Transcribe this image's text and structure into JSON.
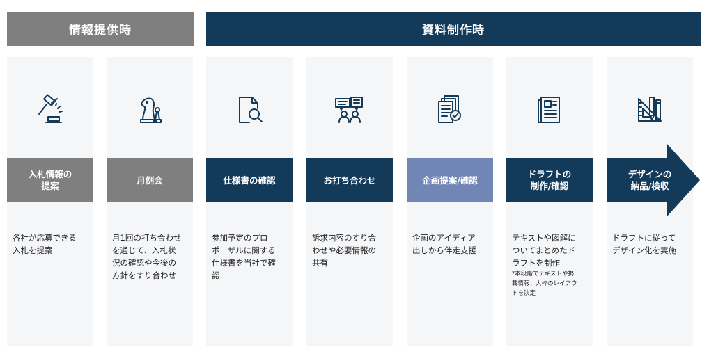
{
  "headers": {
    "left": "情報提供時",
    "right": "資料制作時"
  },
  "steps": [
    {
      "title": "入札情報の\n提案",
      "icon": "gavel-icon",
      "description": "各社が応募できる\n入札を提案"
    },
    {
      "title": "月例会",
      "icon": "chess-icon",
      "description": "月1回の打ち合わせ\nを通じて、入札状\n況の確認や今後の\n方針をすり合わせ"
    },
    {
      "title": "仕様書の確認",
      "icon": "document-search-icon",
      "description": "参加予定のプロ\nポーザルに関する\n仕様書を当社で確\n認"
    },
    {
      "title": "お打ち合わせ",
      "icon": "meeting-icon",
      "description": "訴求内容のすり合\nわせや必要情報の\n共有"
    },
    {
      "title": "企画提案/確認",
      "icon": "documents-check-icon",
      "description": "企画のアイディア\n出しから伴走支援"
    },
    {
      "title": "ドラフトの\n制作/確認",
      "icon": "newspaper-icon",
      "description": "テキストや図解に\nついてまとめたド\nラフトを制作",
      "note": "*本段階でテキストや掲\n載情報、大枠のレイアウ\nトを決定"
    },
    {
      "title": "デザインの\n納品/検収",
      "icon": "design-tools-icon",
      "description": "ドラフトに従って\nデザイン化を実施"
    }
  ],
  "colors": {
    "gray": "#7f7f7f",
    "navy": "#143a5a",
    "light_blue": "#7186b5",
    "column_bg": "#f5f6f8"
  }
}
